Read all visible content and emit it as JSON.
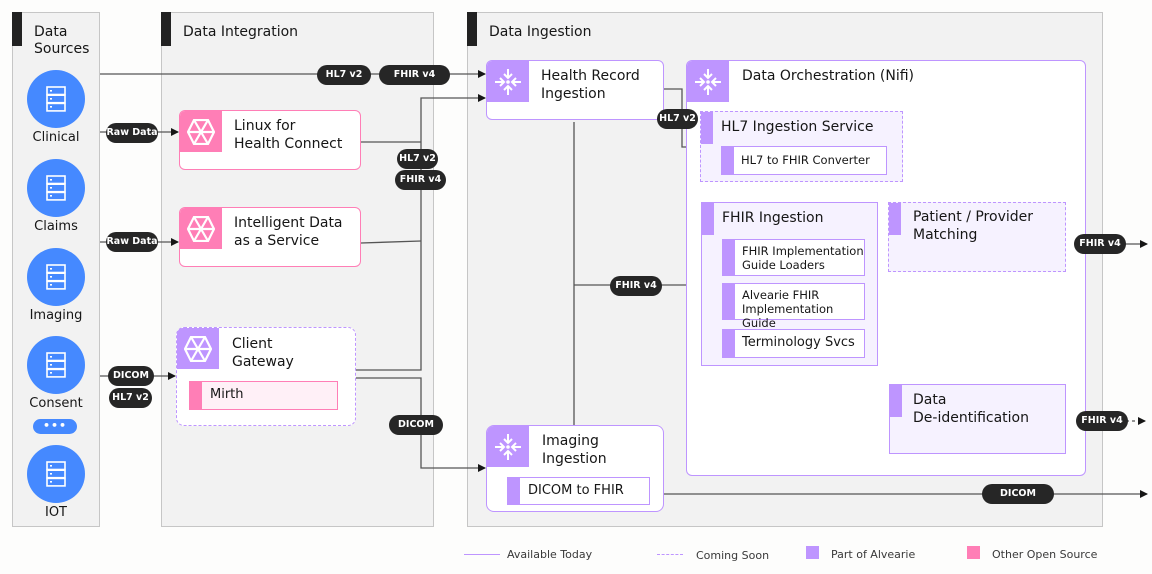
{
  "lanes": {
    "sources": {
      "title": "Data\nSources"
    },
    "integration": {
      "title": "Data Integration"
    },
    "ingestion": {
      "title": "Data Ingestion"
    }
  },
  "sources": [
    {
      "label": "Clinical",
      "icon": "database-icon"
    },
    {
      "label": "Claims",
      "icon": "database-icon"
    },
    {
      "label": "Imaging",
      "icon": "database-icon"
    },
    {
      "label": "Consent",
      "icon": "database-icon"
    },
    {
      "label": "IOT",
      "icon": "database-icon"
    }
  ],
  "more_indicator": "•••",
  "integration": {
    "linux": {
      "title_1": "Linux for",
      "title_2": "Health Connect",
      "icon": "hexagon-icon"
    },
    "idaas": {
      "title_1": "Intelligent Data",
      "title_2": "as a Service",
      "icon": "hexagon-icon"
    },
    "gateway": {
      "title_1": "Client",
      "title_2": "Gateway",
      "icon": "hexagon-icon",
      "sub": "Mirth"
    }
  },
  "ingestion": {
    "health_record": {
      "title_1": "Health Record",
      "title_2": "Ingestion",
      "icon": "converge-icon"
    },
    "imaging": {
      "title_1": "Imaging",
      "title_2": "Ingestion",
      "icon": "converge-icon",
      "sub": "DICOM to FHIR"
    },
    "orchestration": {
      "title": "Data Orchestration (Nifi)",
      "icon": "converge-icon",
      "hl7_service": {
        "title": "HL7 Ingestion Service",
        "sub": "HL7 to FHIR Converter"
      },
      "fhir_ingestion": {
        "title": "FHIR Ingestion",
        "subs": [
          {
            "line_1": "FHIR Implementation",
            "line_2": "Guide Loaders"
          },
          {
            "line_1": "Alvearie FHIR",
            "line_2": "Implementation Guide"
          },
          {
            "line_1": "Terminology Svcs",
            "line_2": ""
          }
        ]
      },
      "matching": {
        "title_1": "Patient / Provider",
        "title_2": "Matching"
      },
      "deid": {
        "title_1": "Data",
        "title_2": "De-identification"
      }
    }
  },
  "tags": {
    "raw_data_1": "Raw Data",
    "raw_data_2": "Raw Data",
    "dicom_src": "DICOM",
    "hl7_src": "HL7 v2",
    "top_hl7": "HL7 v2",
    "top_fhir": "FHIR v4",
    "mid_hl7": "HL7 v2",
    "mid_fhir": "FHIR v4",
    "gw_dicom": "DICOM",
    "hri_hl7": "HL7 v2",
    "fhir_mid": "FHIR v4",
    "out_match": "FHIR v4",
    "out_deid": "FHIR v4",
    "out_dicom": "DICOM"
  },
  "legend": {
    "available": "Available Today",
    "coming": "Coming Soon",
    "alvearie": "Part of Alvearie",
    "other": "Other Open Source"
  },
  "colors": {
    "source_blue": "#4589ff",
    "alvearie_purple": "#be95ff",
    "open_source_pink": "#ff7eb6",
    "tag_dark": "#262626"
  }
}
